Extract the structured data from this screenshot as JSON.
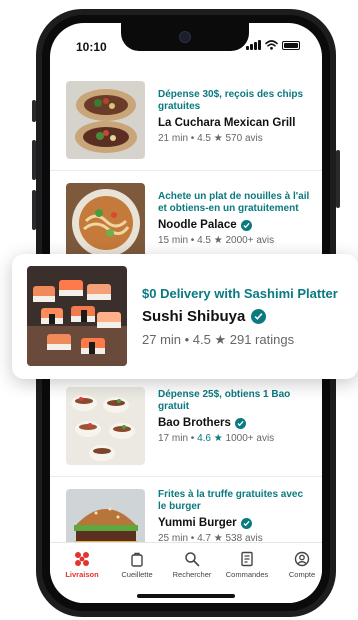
{
  "status": {
    "time": "10:10"
  },
  "restaurants": [
    {
      "promo": "Dépense 30$, reçois des chips gratuites",
      "name": "La Cuchara Mexican Grill",
      "meta": "21 min • 4.5 ★ 570 avis",
      "verified": false
    },
    {
      "promo": "Achete un plat de nouilles à l'ail et obtiens-en un gratuitement",
      "name": "Noodle Palace",
      "meta": "15 min • 4.5 ★ 2000+ avis",
      "verified": true
    },
    {
      "promo": "Dépense 25$, obtiens 1 Bao gratuit",
      "name": "Bao Brothers",
      "meta_time": "17 min • ",
      "meta_rating": "4.6 ★",
      "meta_count": " 1000+ avis",
      "verified": true
    },
    {
      "promo": "Frites à la truffe gratuites avec le burger",
      "name": "Yummi Burger",
      "meta": "25 min • 4.7 ★ 538 avis",
      "verified": true
    }
  ],
  "featured": {
    "promo": "$0 Delivery with Sashimi Platter",
    "name": "Sushi Shibuya",
    "meta": "27 min • 4.5 ★ 291 ratings",
    "verified": true
  },
  "tabs": [
    {
      "label": "Livraison",
      "icon": "delivery-icon",
      "active": true
    },
    {
      "label": "Cueillette",
      "icon": "pickup-bag-icon",
      "active": false
    },
    {
      "label": "Rechercher",
      "icon": "search-icon",
      "active": false
    },
    {
      "label": "Commandes",
      "icon": "orders-receipt-icon",
      "active": false
    },
    {
      "label": "Compte",
      "icon": "account-icon",
      "active": false
    }
  ],
  "colors": {
    "accent": "#0a7a80",
    "active_tab": "#e3342f"
  }
}
